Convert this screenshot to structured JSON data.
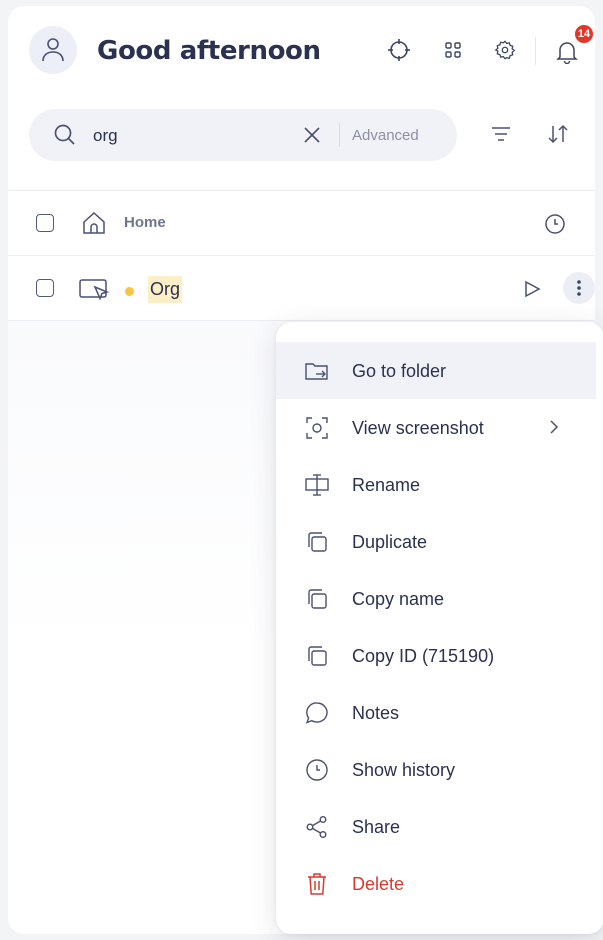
{
  "header": {
    "greeting": "Good afternoon",
    "notification_count": "14"
  },
  "search": {
    "query": "org",
    "advanced_label": "Advanced"
  },
  "rows": [
    {
      "label": "Home"
    },
    {
      "label": "Org",
      "status_color": "#f6c544"
    }
  ],
  "context_menu": {
    "items": [
      {
        "label": "Go to folder",
        "icon": "folder-arrow-icon"
      },
      {
        "label": "View screenshot",
        "icon": "screenshot-icon",
        "has_submenu": true
      },
      {
        "label": "Rename",
        "icon": "rename-icon"
      },
      {
        "label": "Duplicate",
        "icon": "duplicate-icon"
      },
      {
        "label": "Copy name",
        "icon": "copy-icon"
      },
      {
        "label": "Copy ID (715190)",
        "icon": "copy-icon"
      },
      {
        "label": "Notes",
        "icon": "speech-bubble-icon"
      },
      {
        "label": "Show history",
        "icon": "clock-icon"
      },
      {
        "label": "Share",
        "icon": "share-icon"
      },
      {
        "label": "Delete",
        "icon": "trash-icon",
        "color": "#d83a30"
      }
    ]
  },
  "colors": {
    "text": "#2b3150",
    "badge": "#e5362b",
    "highlight": "#fcefc8",
    "danger": "#d83a30"
  }
}
